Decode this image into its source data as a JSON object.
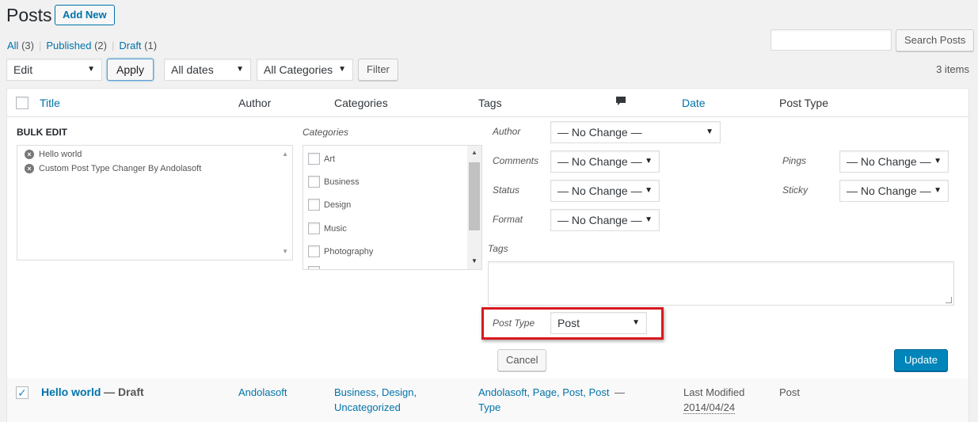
{
  "header": {
    "title": "Posts",
    "add_new": "Add New"
  },
  "filters": {
    "all_label": "All",
    "all_count": "(3)",
    "published_label": "Published",
    "published_count": "(2)",
    "draft_label": "Draft",
    "draft_count": "(1)",
    "separator": "|"
  },
  "search": {
    "button": "Search Posts",
    "value": ""
  },
  "toolbar": {
    "bulk_action": "Edit",
    "apply": "Apply",
    "dates": "All dates",
    "categories": "All Categories",
    "filter": "Filter",
    "items_count": "3 items"
  },
  "columns": {
    "title": "Title",
    "author": "Author",
    "categories": "Categories",
    "tags": "Tags",
    "date": "Date",
    "post_type": "Post Type"
  },
  "bulk_edit": {
    "heading": "BULK EDIT",
    "titles": [
      "Hello world",
      "Custom Post Type Changer By Andolasoft"
    ],
    "categories_label": "Categories",
    "categories": [
      "Art",
      "Business",
      "Design",
      "Music",
      "Photography"
    ],
    "author_label": "Author",
    "comments_label": "Comments",
    "status_label": "Status",
    "format_label": "Format",
    "pings_label": "Pings",
    "sticky_label": "Sticky",
    "no_change": "— No Change —",
    "tags_label": "Tags",
    "post_type_label": "Post Type",
    "post_type_value": "Post",
    "cancel": "Cancel",
    "update": "Update"
  },
  "post_row": {
    "title": "Hello world",
    "state": "— Draft",
    "author": "Andolasoft",
    "categories_line1": "Business, Design,",
    "categories_line2": "Uncategorized",
    "tags_line1": "Andolasoft, Page, Post, Post",
    "tags_line2": "Type",
    "comments": "—",
    "date_status": "Last Modified",
    "date_value": "2014/04/24",
    "post_type": "Post"
  },
  "colors": {
    "link": "#0073aa",
    "primary_button": "#0085ba",
    "highlight_border": "#d9191f"
  }
}
